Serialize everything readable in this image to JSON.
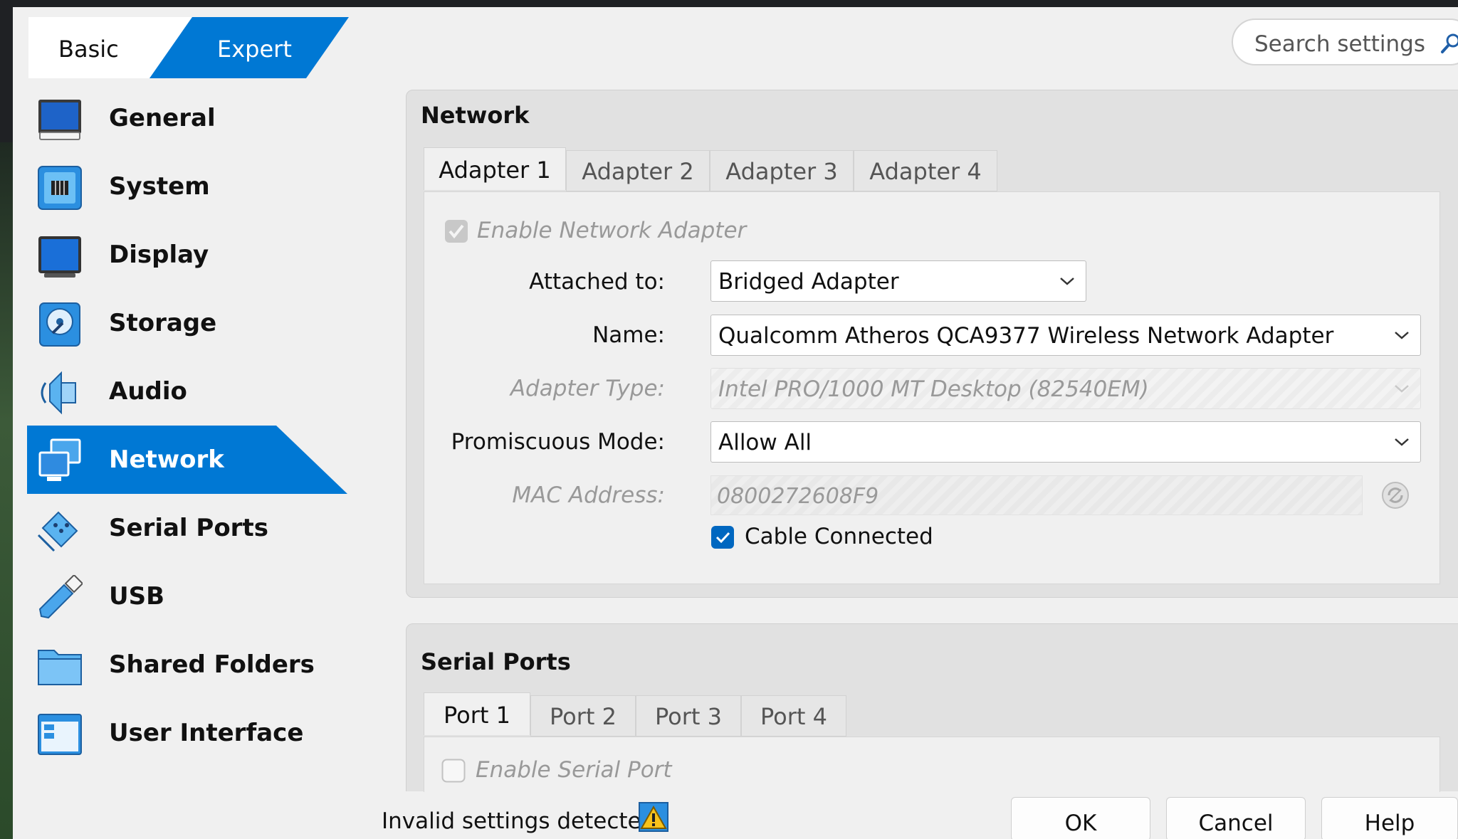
{
  "mode": {
    "basic": "Basic",
    "expert": "Expert"
  },
  "search": {
    "placeholder": "Search settings"
  },
  "sidebar": {
    "items": [
      {
        "label": "General",
        "icon": "general-icon"
      },
      {
        "label": "System",
        "icon": "system-icon"
      },
      {
        "label": "Display",
        "icon": "display-icon"
      },
      {
        "label": "Storage",
        "icon": "storage-icon"
      },
      {
        "label": "Audio",
        "icon": "audio-icon"
      },
      {
        "label": "Network",
        "icon": "network-icon",
        "active": true
      },
      {
        "label": "Serial Ports",
        "icon": "serial-ports-icon"
      },
      {
        "label": "USB",
        "icon": "usb-icon"
      },
      {
        "label": "Shared Folders",
        "icon": "shared-folders-icon"
      },
      {
        "label": "User Interface",
        "icon": "user-interface-icon"
      }
    ]
  },
  "network": {
    "title": "Network",
    "tabs": [
      "Adapter 1",
      "Adapter 2",
      "Adapter 3",
      "Adapter 4"
    ],
    "enable_label": "Enable Network Adapter",
    "attached_label": "Attached to:",
    "attached_value": "Bridged Adapter",
    "name_label": "Name:",
    "name_value": "Qualcomm Atheros QCA9377 Wireless Network Adapter",
    "adapter_type_label": "Adapter Type:",
    "adapter_type_value": "Intel PRO/1000 MT Desktop (82540EM)",
    "promiscuous_label": "Promiscuous Mode:",
    "promiscuous_value": "Allow All",
    "mac_label": "MAC Address:",
    "mac_value": "0800272608F9",
    "cable_label": "Cable Connected"
  },
  "serial": {
    "title": "Serial Ports",
    "tabs": [
      "Port 1",
      "Port 2",
      "Port 3",
      "Port 4"
    ],
    "enable_label": "Enable Serial Port"
  },
  "footer": {
    "status": "Invalid settings detected",
    "ok": "OK",
    "cancel": "Cancel",
    "help": "Help"
  },
  "colors": {
    "accent": "#0078d4",
    "window_bg": "#f0f0f0",
    "disabled_text": "#999999"
  }
}
